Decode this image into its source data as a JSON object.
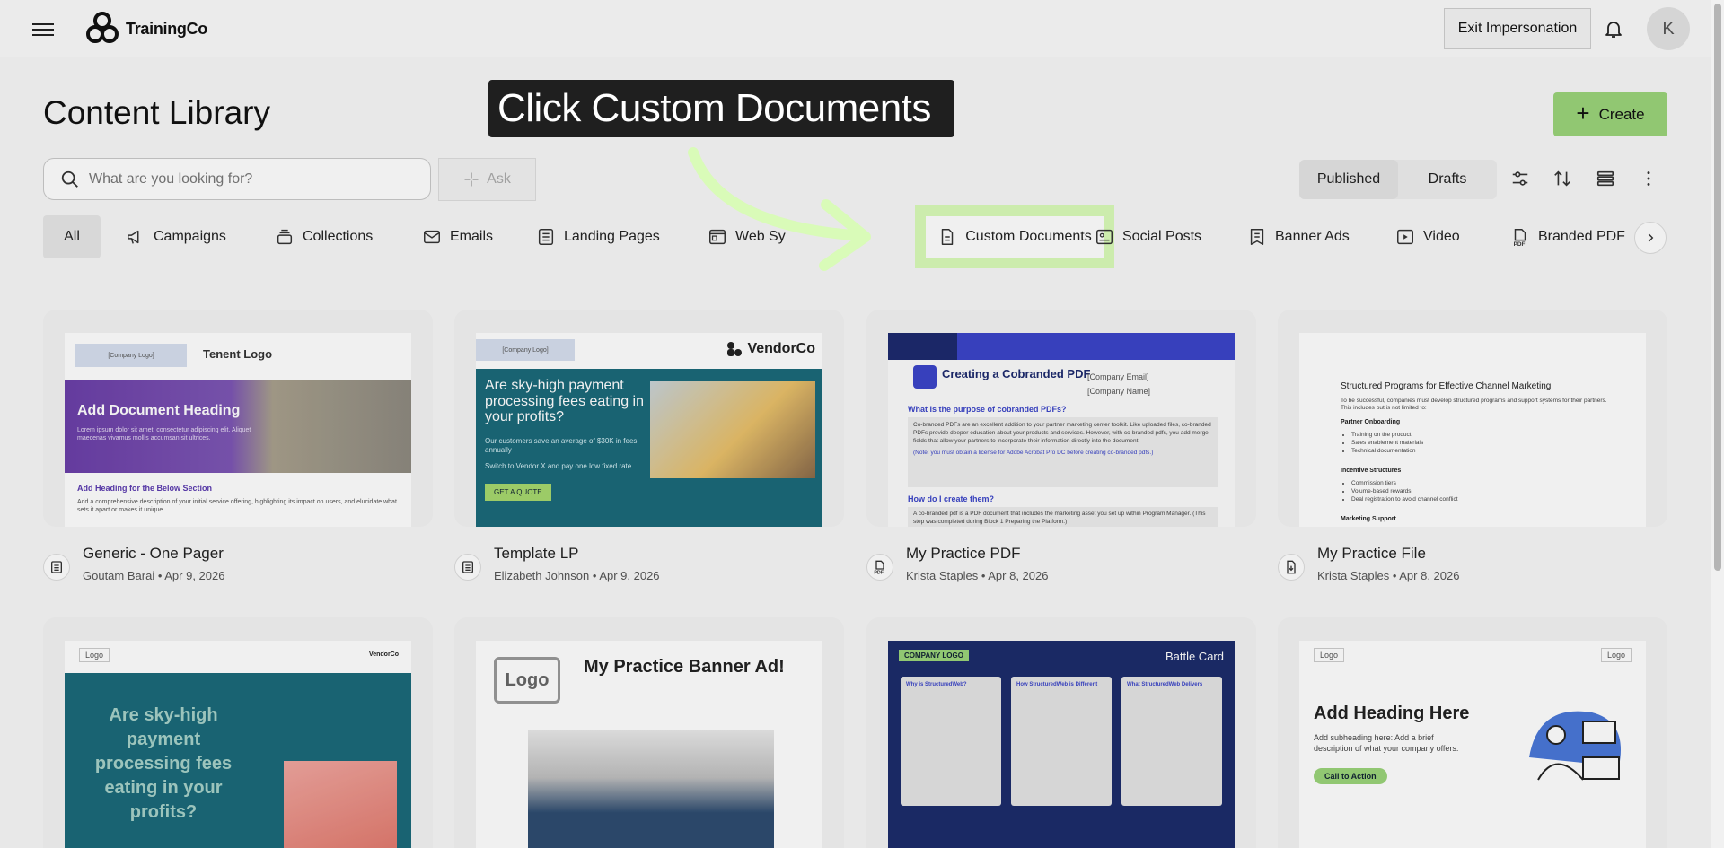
{
  "header": {
    "brand": "TrainingCo",
    "exit_label": "Exit Impersonation",
    "avatar_initial": "K"
  },
  "page": {
    "title": "Content Library",
    "create_label": "Create"
  },
  "search": {
    "placeholder": "What are you looking for?",
    "ask_label": "Ask"
  },
  "view_toggle": {
    "published": "Published",
    "drafts": "Drafts"
  },
  "filters": [
    {
      "label": "All",
      "icon": "none"
    },
    {
      "label": "Campaigns",
      "icon": "megaphone-icon"
    },
    {
      "label": "Collections",
      "icon": "stack-icon"
    },
    {
      "label": "Emails",
      "icon": "mail-icon"
    },
    {
      "label": "Landing Pages",
      "icon": "page-icon"
    },
    {
      "label": "Web Sy",
      "icon": "web-icon"
    },
    {
      "label": "Custom Documents",
      "icon": "document-icon"
    },
    {
      "label": "Social Posts",
      "icon": "social-icon"
    },
    {
      "label": "Banner Ads",
      "icon": "banner-icon"
    },
    {
      "label": "Video",
      "icon": "video-icon"
    },
    {
      "label": "Branded PDF",
      "icon": "pdf-icon"
    }
  ],
  "tooltip": {
    "text": "Click Custom Documents",
    "arrow_color": "#d9fbb8"
  },
  "cards": [
    {
      "name": "Generic - One Pager",
      "author": "Goutam Barai",
      "date": "Apr 9, 2026",
      "type_icon": "page-icon",
      "thumb": {
        "logo": "[Company Logo]",
        "heading": "Tenent Logo",
        "banner_title": "Add Document Heading",
        "banner_text": "Lorem ipsum dolor sit amet, consectetur adipiscing elit. Aliquet maecenas vivamus mollis accumsan sit ultrices.",
        "section_heading": "Add Heading for the Below Section",
        "section_text": "Add a comprehensive description of your initial service offering, highlighting its impact on users, and elucidate what sets it apart or makes it unique."
      }
    },
    {
      "name": "Template LP",
      "author": "Elizabeth Johnson",
      "date": "Apr 9, 2026",
      "type_icon": "page-icon",
      "thumb": {
        "logo": "[Company Logo]",
        "vendor": "VendorCo",
        "headline": "Are sky-high payment processing fees eating in your profits?",
        "text1": "Our customers save an average of $30K in fees annually",
        "text2": "Switch to Vendor X and pay one low fixed rate.",
        "cta": "GET A QUOTE"
      }
    },
    {
      "name": "My Practice PDF",
      "author": "Krista Staples",
      "date": "Apr 8, 2026",
      "type_icon": "pdf-icon",
      "thumb": {
        "title": "Creating a Cobranded PDF",
        "email": "[Company Email]",
        "company": "[Company Name]",
        "q1": "What is the purpose of cobranded PDFs?",
        "a1": "Co-branded PDFs are an excellent addition to your partner marketing center toolkit. Like uploaded files, co-branded PDFs provide deeper education about your products and services. However, with co-branded pdfs, you add merge fields that allow your partners to incorporate their information directly into the document.",
        "note": "(Note: you must obtain a license for Adobe Acrobat Pro DC before creating co-branded pdfs.)",
        "q2": "How do I create them?",
        "a2": "A co-branded pdf is a PDF document that includes the marketing asset you set up within Program Manager. (This step was completed during Block 1 Preparing the Platform.)"
      }
    },
    {
      "name": "My Practice File",
      "author": "Krista Staples",
      "date": "Apr 8, 2026",
      "type_icon": "file-icon",
      "thumb": {
        "title": "Structured Programs for Effective Channel Marketing",
        "intro": "To be successful, companies must develop structured programs and support systems for their partners. This includes but is not limited to:",
        "h1": "Partner Onboarding",
        "l1": [
          "Training on the product",
          "Sales enablement materials",
          "Technical documentation"
        ],
        "h2": "Incentive Structures",
        "l2": [
          "Commission tiers",
          "Volume-based rewards",
          "Deal registration to avoid channel conflict"
        ],
        "h3": "Marketing Support"
      }
    },
    {
      "name": "",
      "thumb": {
        "logo": "Logo",
        "vendor": "VendorCo",
        "headline": "Are sky-high payment processing fees eating in your profits?"
      }
    },
    {
      "name": "",
      "thumb": {
        "logo": "Logo",
        "headline": "My Practice Banner Ad!"
      }
    },
    {
      "name": "",
      "thumb": {
        "badge": "COMPANY LOGO",
        "title": "Battle Card",
        "col1": "Why is StructuredWeb?",
        "col2": "How StructuredWeb is Different",
        "col3": "What StructuredWeb Delivers"
      }
    },
    {
      "name": "",
      "thumb": {
        "logo_left": "Logo",
        "logo_right": "Logo",
        "heading": "Add Heading Here",
        "sub": "Add subheading here: Add a brief description of what your company offers.",
        "cta": "Call to Action"
      }
    }
  ]
}
